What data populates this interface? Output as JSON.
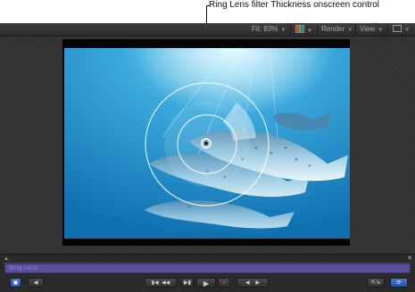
{
  "callout": {
    "text": "Ring Lens filter Thickness onscreen control"
  },
  "toolbar": {
    "fit_label": "Fit:",
    "fit_value": "83%",
    "color_icon": "color-channels-icon",
    "render_label": "Render",
    "view_label": "View",
    "layout_icon": "view-layout-icon"
  },
  "timebar": {
    "track_label": "Ring Lens",
    "buttons": [
      "timeline-toggle-button",
      "audio-toggle-button",
      "go-to-start-button",
      "step-back-button",
      "go-to-end-button",
      "play-button",
      "record-button",
      "previous-keyframe-button",
      "next-keyframe-button",
      "fullscreen-button",
      "loop-button"
    ]
  },
  "colors": {
    "accent": "#3b62c6",
    "track": "#5b4f9a",
    "water": "#1f8fcc"
  }
}
